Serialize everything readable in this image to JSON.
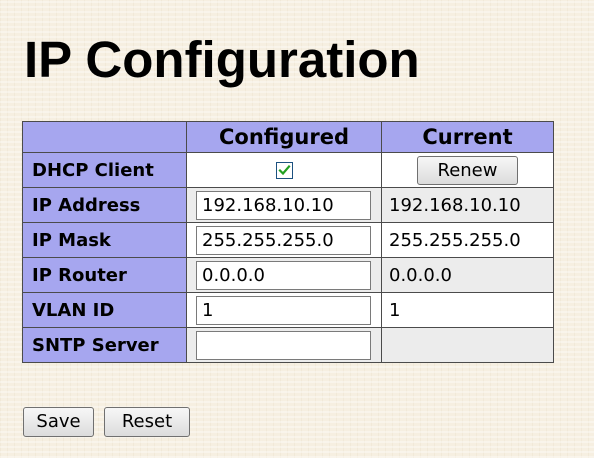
{
  "page": {
    "title": "IP Configuration"
  },
  "table": {
    "headers": {
      "label": "",
      "configured": "Configured",
      "current": "Current"
    },
    "rows": [
      {
        "label": "DHCP Client",
        "type": "checkbox",
        "configured_checked": true,
        "current_button": "Renew"
      },
      {
        "label": "IP Address",
        "type": "input",
        "configured": "192.168.10.10",
        "current": "192.168.10.10"
      },
      {
        "label": "IP Mask",
        "type": "input",
        "configured": "255.255.255.0",
        "current": "255.255.255.0"
      },
      {
        "label": "IP Router",
        "type": "input",
        "configured": "0.0.0.0",
        "current": "0.0.0.0"
      },
      {
        "label": "VLAN ID",
        "type": "input",
        "configured": "1",
        "current": "1"
      },
      {
        "label": "SNTP Server",
        "type": "input",
        "configured": "",
        "current": ""
      }
    ]
  },
  "actions": {
    "save_label": "Save",
    "reset_label": "Reset"
  },
  "colors": {
    "header_background": "#a6a6ef",
    "row_odd": "#ffffff",
    "row_even": "#ececec",
    "checkmark": "#22a022"
  },
  "icons": {
    "dhcp_checkbox": "checkmark-icon"
  }
}
